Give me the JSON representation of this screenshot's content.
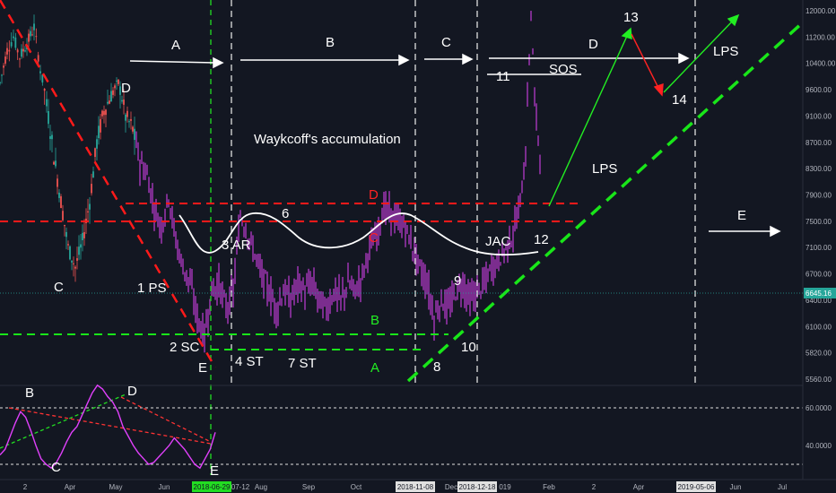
{
  "chart_data": [
    {
      "type": "candlestick",
      "title": "Waykcoff's accumulation",
      "symbol_price": "6645.16",
      "y_ticks": [
        "12000.00",
        "11200.00",
        "10400.00",
        "9600.00",
        "9100.00",
        "8700.00",
        "8300.00",
        "7900.00",
        "7500.00",
        "7100.00",
        "6700.00",
        "6400.00",
        "6100.00",
        "5820.00",
        "5560.00"
      ],
      "x_ticks": [
        "2",
        "Apr",
        "May",
        "Jun",
        "2018-06-29",
        "07-12",
        "Aug",
        "Sep",
        "Oct",
        "2018-11-08",
        "Dec",
        "2018-12-18",
        "019",
        "Feb",
        "2",
        "Apr",
        "2019-05-06",
        "Jun",
        "Jul"
      ],
      "highlighted_dates": [
        "2018-06-29"
      ],
      "price_path": [
        [
          0,
          9800
        ],
        [
          8,
          10800
        ],
        [
          15,
          11200
        ],
        [
          22,
          10600
        ],
        [
          30,
          11000
        ],
        [
          38,
          11500
        ],
        [
          45,
          10200
        ],
        [
          52,
          9300
        ],
        [
          60,
          8500
        ],
        [
          68,
          7800
        ],
        [
          76,
          7100
        ],
        [
          84,
          6800
        ],
        [
          92,
          7200
        ],
        [
          100,
          7800
        ],
        [
          108,
          8700
        ],
        [
          116,
          9200
        ],
        [
          124,
          9500
        ],
        [
          132,
          9800
        ],
        [
          140,
          9100
        ],
        [
          148,
          8900
        ],
        [
          156,
          8400
        ],
        [
          164,
          8200
        ],
        [
          172,
          7700
        ],
        [
          180,
          7400
        ],
        [
          188,
          7900
        ],
        [
          196,
          7200
        ],
        [
          204,
          6800
        ],
        [
          212,
          6600
        ],
        [
          220,
          6200
        ],
        [
          228,
          6000
        ],
        [
          236,
          6500
        ],
        [
          244,
          6600
        ],
        [
          252,
          6300
        ],
        [
          260,
          6500
        ],
        [
          268,
          7600
        ],
        [
          276,
          7300
        ],
        [
          284,
          7000
        ],
        [
          292,
          6700
        ],
        [
          300,
          6500
        ],
        [
          308,
          6300
        ],
        [
          316,
          6500
        ],
        [
          324,
          6400
        ],
        [
          332,
          6600
        ],
        [
          340,
          6500
        ],
        [
          348,
          6600
        ],
        [
          356,
          6400
        ],
        [
          364,
          6300
        ],
        [
          372,
          6500
        ],
        [
          380,
          6400
        ],
        [
          388,
          6600
        ],
        [
          396,
          6500
        ],
        [
          404,
          6700
        ],
        [
          412,
          7100
        ],
        [
          420,
          7300
        ],
        [
          428,
          7700
        ],
        [
          436,
          7600
        ],
        [
          444,
          7500
        ],
        [
          452,
          7400
        ],
        [
          460,
          7100
        ],
        [
          468,
          6800
        ],
        [
          476,
          6600
        ],
        [
          484,
          6200
        ],
        [
          492,
          6400
        ],
        [
          500,
          6300
        ],
        [
          508,
          6500
        ],
        [
          516,
          6600
        ],
        [
          524,
          6400
        ],
        [
          532,
          6500
        ],
        [
          540,
          6600
        ],
        [
          548,
          6800
        ],
        [
          556,
          6900
        ],
        [
          564,
          7100
        ],
        [
          572,
          7300
        ],
        [
          580,
          7800
        ],
        [
          586,
          8500
        ],
        [
          590,
          10500
        ],
        [
          592,
          12000
        ],
        [
          596,
          9400
        ],
        [
          600,
          8800
        ],
        [
          604,
          8300
        ]
      ],
      "annotations": {
        "phases": [
          "A",
          "B",
          "C",
          "D",
          "E"
        ],
        "points": [
          "1 PS",
          "2 SC",
          "3 AR",
          "4 ST",
          "6",
          "7 ST",
          "8",
          "9",
          "10",
          "11",
          "12",
          "13",
          "14"
        ],
        "events": [
          "D",
          "C",
          "E",
          "SOS",
          "LPS",
          "LPS",
          "JAC"
        ],
        "levels": [
          "D",
          "C",
          "B",
          "A"
        ]
      },
      "colors": {
        "up": "#26a69a",
        "down": "#ef5350",
        "purple": "#7b2d8e",
        "support": "#19e619",
        "resistance": "#ff1a1a"
      }
    },
    {
      "type": "line",
      "name": "oscillator",
      "y_ticks": [
        "60.0000",
        "40.0000"
      ],
      "ylim": [
        25,
        75
      ],
      "labels": [
        "B",
        "C",
        "D",
        "E"
      ],
      "values": [
        35,
        38,
        45,
        52,
        58,
        55,
        48,
        40,
        33,
        30,
        28,
        31,
        36,
        42,
        47,
        50,
        56,
        62,
        68,
        72,
        70,
        66,
        63,
        58,
        50,
        45,
        40,
        36,
        33,
        30,
        31,
        34,
        37,
        40,
        44,
        41,
        38,
        34,
        30,
        28,
        33,
        38,
        47
      ],
      "colors": {
        "line": "#e040fb",
        "trend_down": "#ff3333",
        "trend_up": "#22dd22"
      }
    }
  ]
}
